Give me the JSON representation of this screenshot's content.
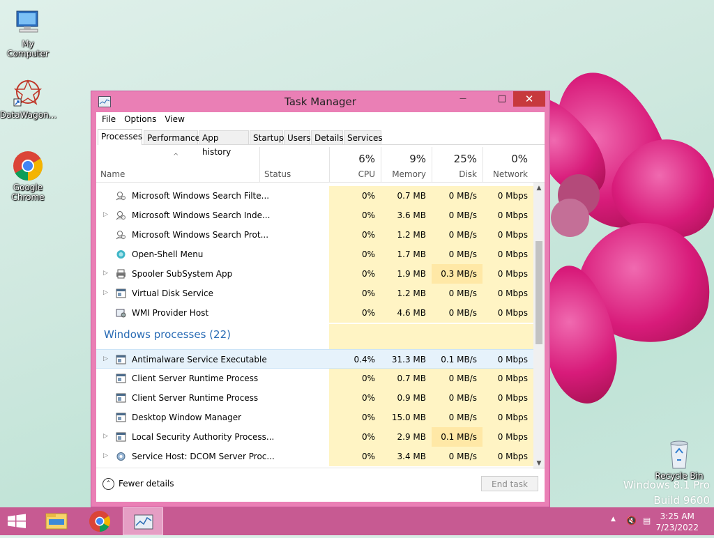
{
  "desktop": {
    "icons": [
      {
        "label": "My Computer",
        "icon": "computer-icon"
      },
      {
        "label": "DataWagon...",
        "icon": "datawagon-icon"
      },
      {
        "label": "Google Chrome",
        "icon": "chrome-icon"
      }
    ],
    "recycle_bin": "Recycle Bin",
    "watermark_line1": "Windows 8.1 Pro",
    "watermark_line2": "Build 9600"
  },
  "window": {
    "title": "Task Manager",
    "controls": {
      "minimize": "—",
      "maximize": "□",
      "close": "✕"
    },
    "menu": [
      "File",
      "Options",
      "View"
    ],
    "tabs": [
      "Processes",
      "Performance",
      "App history",
      "Startup",
      "Users",
      "Details",
      "Services"
    ],
    "active_tab": "Processes",
    "columns": {
      "name": "Name",
      "status": "Status",
      "cpu": {
        "pct": "6%",
        "label": "CPU"
      },
      "memory": {
        "pct": "9%",
        "label": "Memory"
      },
      "disk": {
        "pct": "25%",
        "label": "Disk"
      },
      "network": {
        "pct": "0%",
        "label": "Network"
      }
    },
    "group_title": "Windows processes (22)",
    "rows_top": [
      {
        "name": "Microsoft Windows Search Filte...",
        "expandable": false,
        "icon": "search-service-icon",
        "cpu": "0%",
        "memory": "0.7 MB",
        "disk": "0 MB/s",
        "network": "0 Mbps"
      },
      {
        "name": "Microsoft Windows Search Inde...",
        "expandable": true,
        "icon": "search-service-icon",
        "cpu": "0%",
        "memory": "3.6 MB",
        "disk": "0 MB/s",
        "network": "0 Mbps"
      },
      {
        "name": "Microsoft Windows Search Prot...",
        "expandable": false,
        "icon": "search-service-icon",
        "cpu": "0%",
        "memory": "1.2 MB",
        "disk": "0 MB/s",
        "network": "0 Mbps"
      },
      {
        "name": "Open-Shell Menu",
        "expandable": false,
        "icon": "shell-icon",
        "cpu": "0%",
        "memory": "1.7 MB",
        "disk": "0 MB/s",
        "network": "0 Mbps"
      },
      {
        "name": "Spooler SubSystem App",
        "expandable": true,
        "icon": "printer-icon",
        "cpu": "0%",
        "memory": "1.9 MB",
        "disk": "0.3 MB/s",
        "network": "0 Mbps"
      },
      {
        "name": "Virtual Disk Service",
        "expandable": true,
        "icon": "service-window-icon",
        "cpu": "0%",
        "memory": "1.2 MB",
        "disk": "0 MB/s",
        "network": "0 Mbps"
      },
      {
        "name": "WMI Provider Host",
        "expandable": false,
        "icon": "wmi-icon",
        "cpu": "0%",
        "memory": "4.6 MB",
        "disk": "0 MB/s",
        "network": "0 Mbps"
      }
    ],
    "rows_bottom": [
      {
        "name": "Antimalware Service Executable",
        "expandable": true,
        "icon": "service-window-icon",
        "cpu": "0.4%",
        "memory": "31.3 MB",
        "disk": "0.1 MB/s",
        "network": "0 Mbps",
        "selected": true
      },
      {
        "name": "Client Server Runtime Process",
        "expandable": false,
        "icon": "service-window-icon",
        "cpu": "0%",
        "memory": "0.7 MB",
        "disk": "0 MB/s",
        "network": "0 Mbps"
      },
      {
        "name": "Client Server Runtime Process",
        "expandable": false,
        "icon": "service-window-icon",
        "cpu": "0%",
        "memory": "0.9 MB",
        "disk": "0 MB/s",
        "network": "0 Mbps"
      },
      {
        "name": "Desktop Window Manager",
        "expandable": false,
        "icon": "service-window-icon",
        "cpu": "0%",
        "memory": "15.0 MB",
        "disk": "0 MB/s",
        "network": "0 Mbps"
      },
      {
        "name": "Local Security Authority Process...",
        "expandable": true,
        "icon": "service-window-icon",
        "cpu": "0%",
        "memory": "2.9 MB",
        "disk": "0.1 MB/s",
        "network": "0 Mbps"
      },
      {
        "name": "Service Host: DCOM Server Proc...",
        "expandable": true,
        "icon": "gear-icon",
        "cpu": "0%",
        "memory": "3.4 MB",
        "disk": "0 MB/s",
        "network": "0 Mbps"
      }
    ],
    "footer": {
      "fewer_details": "Fewer details",
      "end_task": "End task"
    }
  },
  "taskbar": {
    "items": [
      "start-icon",
      "file-explorer-icon",
      "chrome-icon",
      "task-manager-icon"
    ],
    "time": "3:25 AM",
    "date": "7/23/2022"
  },
  "colors": {
    "window_frame": "#ea7fb5",
    "close_button": "#c7393d",
    "taskbar": "#c75a92",
    "group_title": "#2a6cb5",
    "usage_cell": "#fff4c4",
    "usage_cell_high": "#ffe8a6"
  }
}
